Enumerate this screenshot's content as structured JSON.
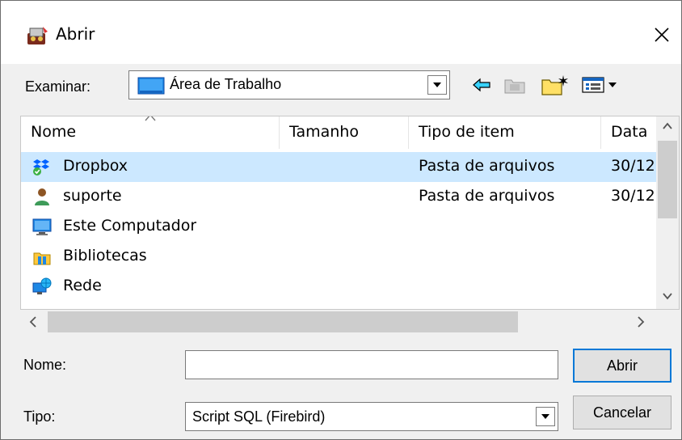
{
  "window": {
    "title": "Abrir"
  },
  "lookin": {
    "label": "Examinar:",
    "value": "Área de Trabalho"
  },
  "toolbar": {
    "back_icon": "back-arrow-icon",
    "up_icon": "up-folder-icon",
    "new_folder_icon": "new-folder-icon",
    "view_menu_icon": "view-menu-icon"
  },
  "file_list": {
    "columns": [
      "Nome",
      "Tamanho",
      "Tipo de item",
      "Data"
    ],
    "rows": [
      {
        "name": "Dropbox",
        "size": "",
        "type": "Pasta de arquivos",
        "date": "30/12",
        "icon": "dropbox-icon",
        "selected": true
      },
      {
        "name": "suporte",
        "size": "",
        "type": "Pasta de arquivos",
        "date": "30/12",
        "icon": "user-folder-icon",
        "selected": false
      },
      {
        "name": "Este Computador",
        "size": "",
        "type": "",
        "date": "",
        "icon": "computer-icon",
        "selected": false
      },
      {
        "name": "Bibliotecas",
        "size": "",
        "type": "",
        "date": "",
        "icon": "libraries-icon",
        "selected": false
      },
      {
        "name": "Rede",
        "size": "",
        "type": "",
        "date": "",
        "icon": "network-icon",
        "selected": false
      }
    ]
  },
  "name_field": {
    "label": "Nome:",
    "value": ""
  },
  "type_field": {
    "label": "Tipo:",
    "value": "Script SQL (Firebird)"
  },
  "buttons": {
    "open": "Abrir",
    "cancel": "Cancelar"
  },
  "colors": {
    "selection": "#cce8ff",
    "default_button_border": "#0078d7"
  }
}
